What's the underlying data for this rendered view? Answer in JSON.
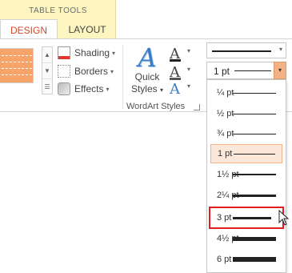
{
  "context": {
    "title": "TABLE TOOLS"
  },
  "tabs": [
    {
      "label": "DESIGN"
    },
    {
      "label": "LAYOUT"
    }
  ],
  "table_styles": {
    "shading": "Shading",
    "borders": "Borders",
    "effects": "Effects"
  },
  "wordart": {
    "quick_styles_line1": "Quick",
    "quick_styles_line2": "Styles",
    "text_fill_glyph": "A",
    "text_outline_glyph": "A",
    "text_effects_glyph": "A",
    "group_label": "WordArt Styles"
  },
  "pen": {
    "weight_value": "1 pt"
  },
  "weights": [
    {
      "label": "¼ pt"
    },
    {
      "label": "½ pt"
    },
    {
      "label": "¾ pt"
    },
    {
      "label": "1 pt"
    },
    {
      "label": "1½ pt"
    },
    {
      "label": "2¼ pt"
    },
    {
      "label": "3 pt"
    },
    {
      "label": "4½ pt"
    },
    {
      "label": "6 pt"
    }
  ],
  "colors": {
    "accent": "#d24726",
    "context_band": "#fcf5c0",
    "highlight": "#e02020",
    "selected_bg": "#fde7d8"
  },
  "icons": [
    "shading-icon",
    "borders-icon",
    "effects-icon",
    "text-fill-icon",
    "text-outline-icon",
    "text-effects-icon",
    "dropdown-arrow-icon",
    "mouse-cursor-icon"
  ]
}
